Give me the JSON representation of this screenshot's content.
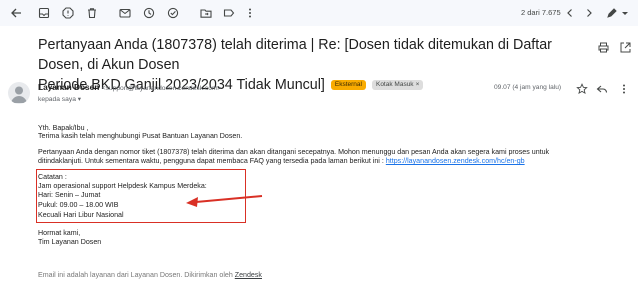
{
  "toolbar": {
    "icons": [
      "back-arrow-icon",
      "archive-icon",
      "report-spam-icon",
      "delete-icon",
      "mark-unread-icon",
      "snooze-icon",
      "add-to-tasks-icon",
      "move-to-icon",
      "label-icon",
      "more-icon"
    ],
    "counter": "2 dari 7.675",
    "right_icons": [
      "newer-icon",
      "older-icon",
      "input-tools-icon",
      "dropdown-icon"
    ]
  },
  "email": {
    "subject_line1": "Pertanyaan Anda (1807378) telah diterima | Re: [Dosen tidak ditemukan di Daftar Dosen, di Akun Dosen",
    "subject_line2": "Periode BKD Ganjil 2023/2034 Tidak Muncul]",
    "label_external": "Eksternal",
    "label_inbox": "Kotak Masuk",
    "label_inbox_close": "×",
    "sender_name": "Layanan Dosen",
    "sender_email": "<support@layanandosen.zendesk.com>",
    "recipient": "kepada saya",
    "date": "09.07 (4 jam yang lalu)"
  },
  "body": {
    "greeting": "Yth. Bapak/Ibu ,",
    "thanks": "Terima kasih telah menghubungi Pusat Bantuan Layanan Dosen.",
    "para1_line1": "Pertanyaan Anda dengan nomor tiket (1807378) telah diterima dan akan ditangani secepatnya. Mohon menunggu dan pesan Anda akan segera kami proses untuk",
    "para1_line2": "ditindaklanjuti. Untuk sementara waktu, pengguna dapat membaca FAQ yang tersedia pada laman berikut ini : ",
    "faq_link": "https://layanandosen.zendesk.com/hc/en-gb",
    "notes_title": "Catatan :",
    "notes_line1": "Jam operasional support Helpdesk Kampus Merdeka:",
    "notes_line2": "Hari: Senin – Jumat",
    "notes_line3": "Pukul: 09.00 – 18.00 WIB",
    "notes_line4": "Kecuali Hari Libur Nasional",
    "closing": "Hormat kami,",
    "signature": "Tim Layanan Dosen"
  },
  "footer": {
    "text": "Email ini adalah layanan dari Layanan Dosen. Dikirimkan oleh ",
    "link": "Zendesk"
  },
  "colors": {
    "toolbar_bg": "#f6f8fc",
    "label_external": "#f9ab00",
    "link": "#1a73e8",
    "annotation": "#d93025"
  }
}
